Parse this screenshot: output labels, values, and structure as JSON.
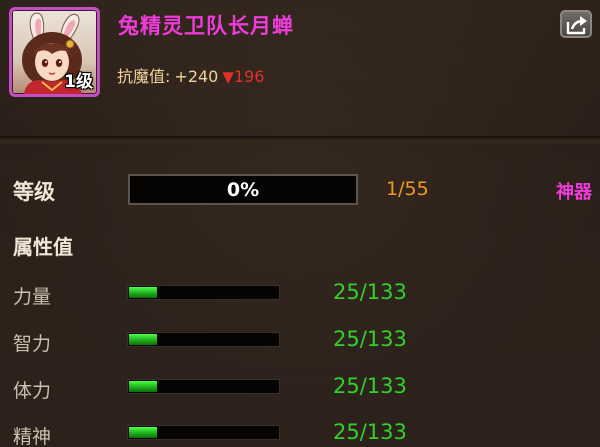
{
  "character": {
    "name": "兔精灵卫队长月蝉",
    "level_badge": "1级",
    "resist_label": "抗魔值:",
    "resist_plus": "+240",
    "resist_down": "196"
  },
  "level": {
    "label": "等级",
    "progress_text": "0%",
    "progress_value": 0,
    "count": "1/55",
    "artifact_link": "神器"
  },
  "attributes": {
    "heading": "属性值",
    "items": [
      {
        "name": "力量",
        "value": "25/133",
        "fill": 0.188
      },
      {
        "name": "智力",
        "value": "25/133",
        "fill": 0.188
      },
      {
        "name": "体力",
        "value": "25/133",
        "fill": 0.188
      },
      {
        "name": "精神",
        "value": "25/133",
        "fill": 0.188
      }
    ]
  },
  "icons": {
    "share": "share-export-icon",
    "down_arrow": "down-triangle-icon"
  },
  "colors": {
    "name": "#ee3cd9",
    "resist": "#f1d39a",
    "decrease": "#e4302b",
    "count": "#f29a1c",
    "attr_value": "#31d12c",
    "portrait_border": "#c44dc0"
  }
}
